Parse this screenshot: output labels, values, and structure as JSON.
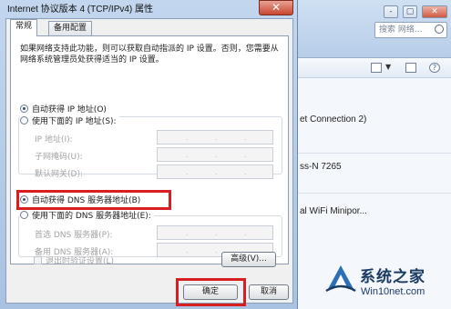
{
  "dialog": {
    "title": "Internet 协议版本 4 (TCP/IPv4) 属性",
    "close_label": "✕",
    "tabs": [
      "常规",
      "备用配置"
    ],
    "description": "如果网络支持此功能，则可以获取自动指派的 IP 设置。否则，您需要从网络系统管理员处获得适当的 IP 设置。",
    "ip_auto_label": "自动获得 IP 地址(O)",
    "ip_manual_label": "使用下面的 IP 地址(S):",
    "ip_fields": [
      "IP 地址(I):",
      "子网掩码(U):",
      "默认网关(D):"
    ],
    "dns_auto_label": "自动获得 DNS 服务器地址(B)",
    "dns_manual_label": "使用下面的 DNS 服务器地址(E):",
    "dns_fields": [
      "首选 DNS 服务器(P):",
      "备用 DNS 服务器(A):"
    ],
    "validate_label": "退出时验证设置(L)",
    "advanced_label": "高级(V)...",
    "ok_label": "确定",
    "cancel_label": "取消",
    "ip_mode": "auto",
    "dns_mode": "auto",
    "validate_checked": false,
    "highlight_color": "#d81e1e"
  },
  "background": {
    "search_placeholder": "搜索 网络...",
    "window_controls": [
      "-",
      "▢",
      "✕"
    ],
    "connections": [
      "et Connection 2)",
      "ss-N 7265",
      "al WiFi Minipor..."
    ]
  },
  "watermark": {
    "title": "系统之家",
    "url": "Win10net.com"
  }
}
